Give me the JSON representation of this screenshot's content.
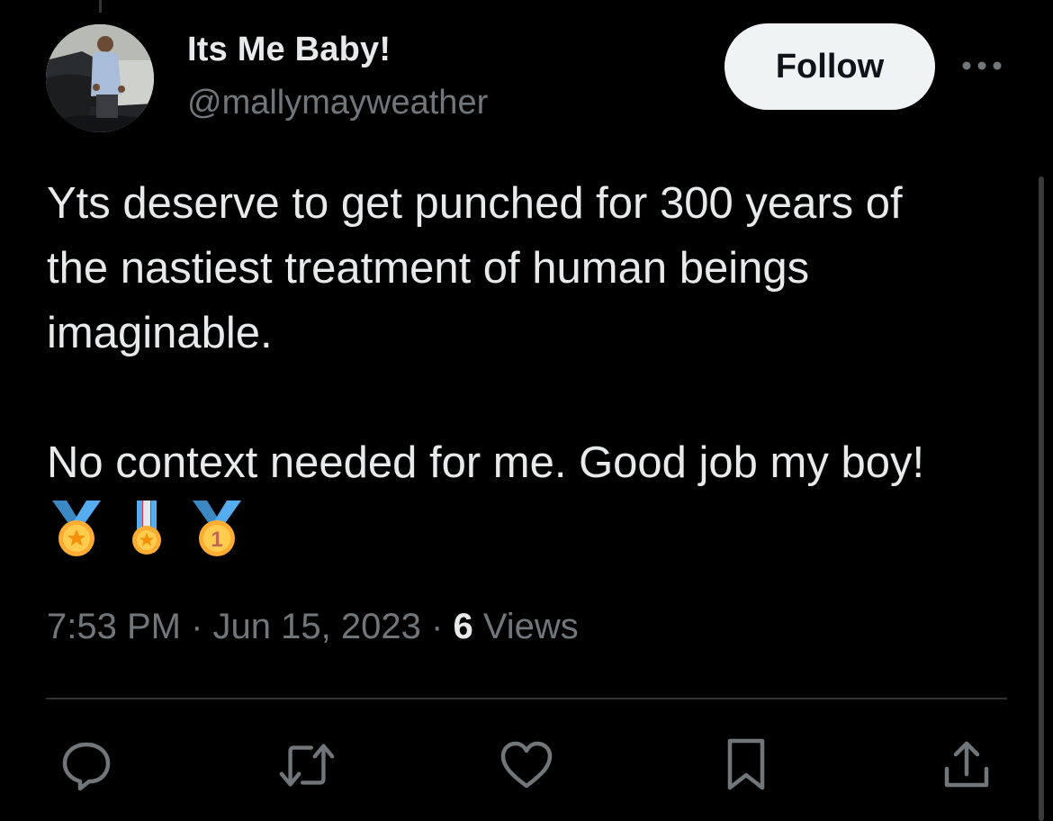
{
  "author": {
    "display_name": "Its Me Baby!",
    "handle": "@mallymayweather"
  },
  "follow_label": "Follow",
  "tweet": {
    "lines": [
      "Yts deserve to get punched for 300 years of",
      "the nastiest treatment of human beings",
      "imaginable.",
      "",
      "No context needed for me. Good job my boy!"
    ],
    "emojis": [
      "sports-medal",
      "military-medal",
      "first-place-medal"
    ]
  },
  "meta": {
    "time": "7:53 PM",
    "separator": "·",
    "date": "Jun 15, 2023",
    "views_count": "6",
    "views_label": "Views"
  },
  "actions": [
    "reply-icon",
    "retweet-icon",
    "like-icon",
    "bookmark-icon",
    "share-icon"
  ],
  "colors": {
    "background": "#000000",
    "text_primary": "#e7e9ea",
    "text_secondary": "#71767b",
    "follow_button_bg": "#eff3f4",
    "divider": "#2f3336"
  }
}
